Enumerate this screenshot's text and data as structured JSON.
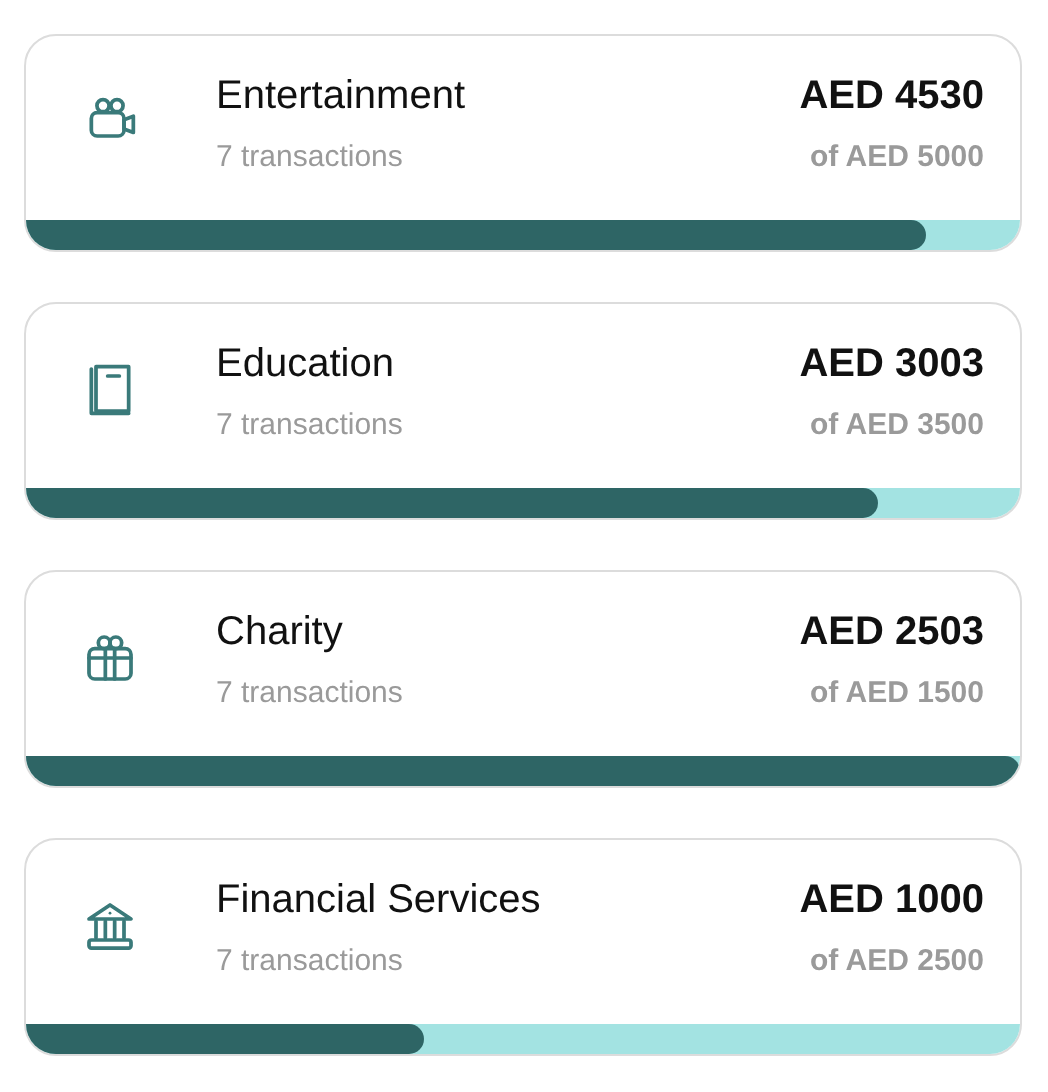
{
  "categories": [
    {
      "kind": "camera",
      "name": "Entertainment",
      "transactions": "7 transactions",
      "amount": "AED 4530",
      "budget": "of AED 5000",
      "level": 0.906
    },
    {
      "kind": "book",
      "name": "Education",
      "transactions": "7 transactions",
      "amount": "AED 3003",
      "budget": "of AED 3500",
      "level": 0.858
    },
    {
      "kind": "gift",
      "name": "Charity",
      "transactions": "7 transactions",
      "amount": "AED 2503",
      "budget": "of AED 1500",
      "level": 1
    },
    {
      "kind": "bank",
      "name": "Financial Services",
      "transactions": "7 transactions",
      "amount": "AED 1000",
      "budget": "of AED 2500",
      "level": 0.4
    }
  ]
}
